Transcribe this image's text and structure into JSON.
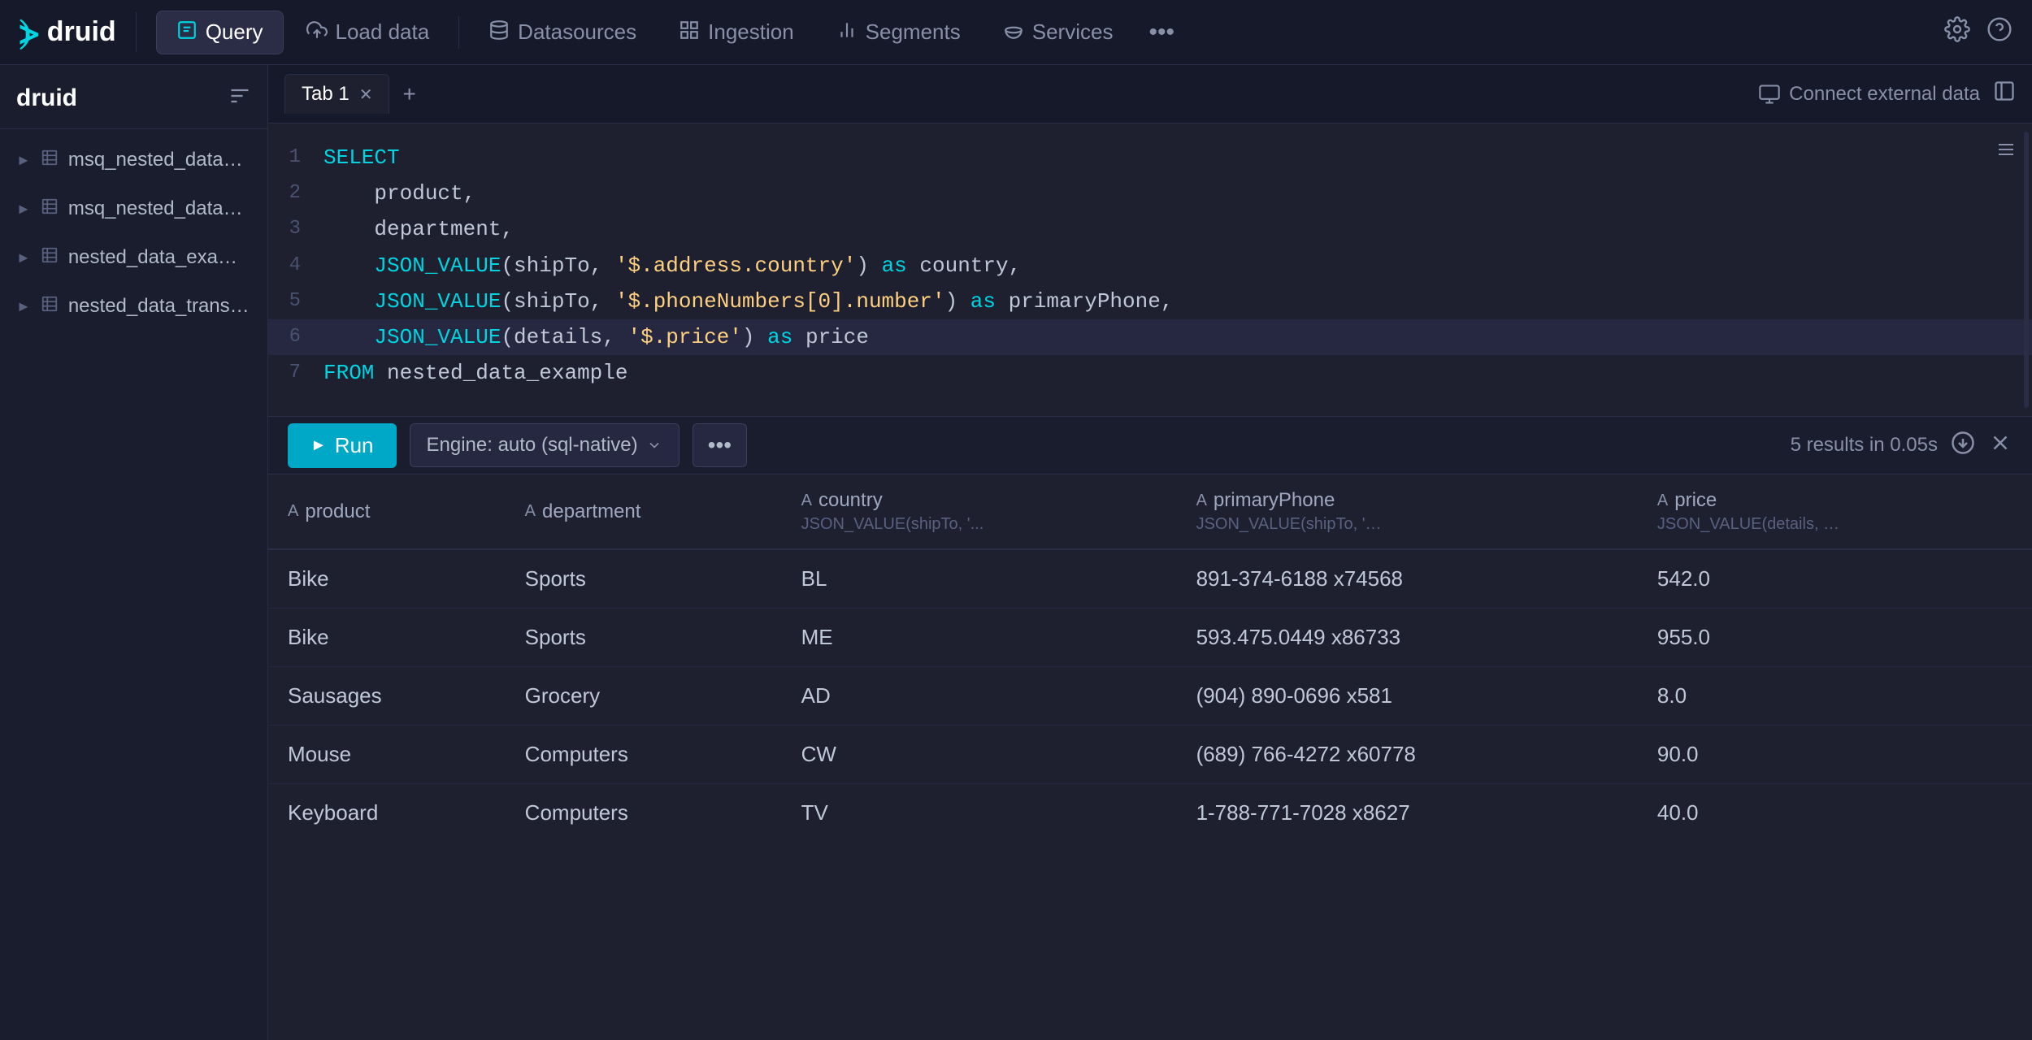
{
  "nav": {
    "logo_text": "druid",
    "items": [
      {
        "id": "query",
        "label": "Query",
        "icon": "◧",
        "active": true
      },
      {
        "id": "load-data",
        "label": "Load data",
        "icon": "⬆",
        "active": false
      },
      {
        "id": "datasources",
        "label": "Datasources",
        "icon": "⬡",
        "active": false
      },
      {
        "id": "ingestion",
        "label": "Ingestion",
        "icon": "⣿",
        "active": false
      },
      {
        "id": "segments",
        "label": "Segments",
        "icon": "⊞",
        "active": false
      },
      {
        "id": "services",
        "label": "Services",
        "icon": "⬡",
        "active": false
      }
    ],
    "more_label": "•••",
    "gear_icon": "⚙",
    "help_icon": "?"
  },
  "sidebar": {
    "title": "druid",
    "items": [
      {
        "name": "msq_nested_data_example"
      },
      {
        "name": "msq_nested_data_transform_ex"
      },
      {
        "name": "nested_data_example"
      },
      {
        "name": "nested_data_transform_exampl"
      }
    ]
  },
  "tabs": [
    {
      "label": "Tab 1",
      "active": true
    }
  ],
  "connect_external": "Connect external data",
  "editor": {
    "lines": [
      {
        "num": "1",
        "content": "SELECT",
        "type": "keyword"
      },
      {
        "num": "2",
        "content": "    product,",
        "type": "plain"
      },
      {
        "num": "3",
        "content": "    department,",
        "type": "plain"
      },
      {
        "num": "4",
        "content": "    JSON_VALUE(shipTo, '$.address.country') as country,",
        "type": "mixed"
      },
      {
        "num": "5",
        "content": "    JSON_VALUE(shipTo, '$.phoneNumbers[0].number') as primaryPhone,",
        "type": "mixed"
      },
      {
        "num": "6",
        "content": "    JSON_VALUE(details, '$.price') as price",
        "type": "mixed"
      },
      {
        "num": "7",
        "content": "FROM nested_data_example",
        "type": "from"
      }
    ]
  },
  "toolbar": {
    "run_label": "Run",
    "engine_label": "Engine: auto (sql-native)",
    "more_label": "•••",
    "results_info": "5 results in 0.05s"
  },
  "results": {
    "columns": [
      {
        "name": "product",
        "icon": "A",
        "sub": ""
      },
      {
        "name": "department",
        "icon": "A",
        "sub": ""
      },
      {
        "name": "country",
        "icon": "A",
        "sub": "JSON_VALUE(shipTo, '..."
      },
      {
        "name": "primaryPhone",
        "icon": "A",
        "sub": "JSON_VALUE(shipTo, '…"
      },
      {
        "name": "price",
        "icon": "A",
        "sub": "JSON_VALUE(details, …"
      }
    ],
    "rows": [
      {
        "product": "Bike",
        "department": "Sports",
        "country": "BL",
        "primaryPhone": "891-374-6188 x74568",
        "price": "542.0"
      },
      {
        "product": "Bike",
        "department": "Sports",
        "country": "ME",
        "primaryPhone": "593.475.0449 x86733",
        "price": "955.0"
      },
      {
        "product": "Sausages",
        "department": "Grocery",
        "country": "AD",
        "primaryPhone": "(904) 890-0696 x581",
        "price": "8.0"
      },
      {
        "product": "Mouse",
        "department": "Computers",
        "country": "CW",
        "primaryPhone": "(689) 766-4272 x60778",
        "price": "90.0"
      },
      {
        "product": "Keyboard",
        "department": "Computers",
        "country": "TV",
        "primaryPhone": "1-788-771-7028 x8627",
        "price": "40.0"
      }
    ]
  }
}
